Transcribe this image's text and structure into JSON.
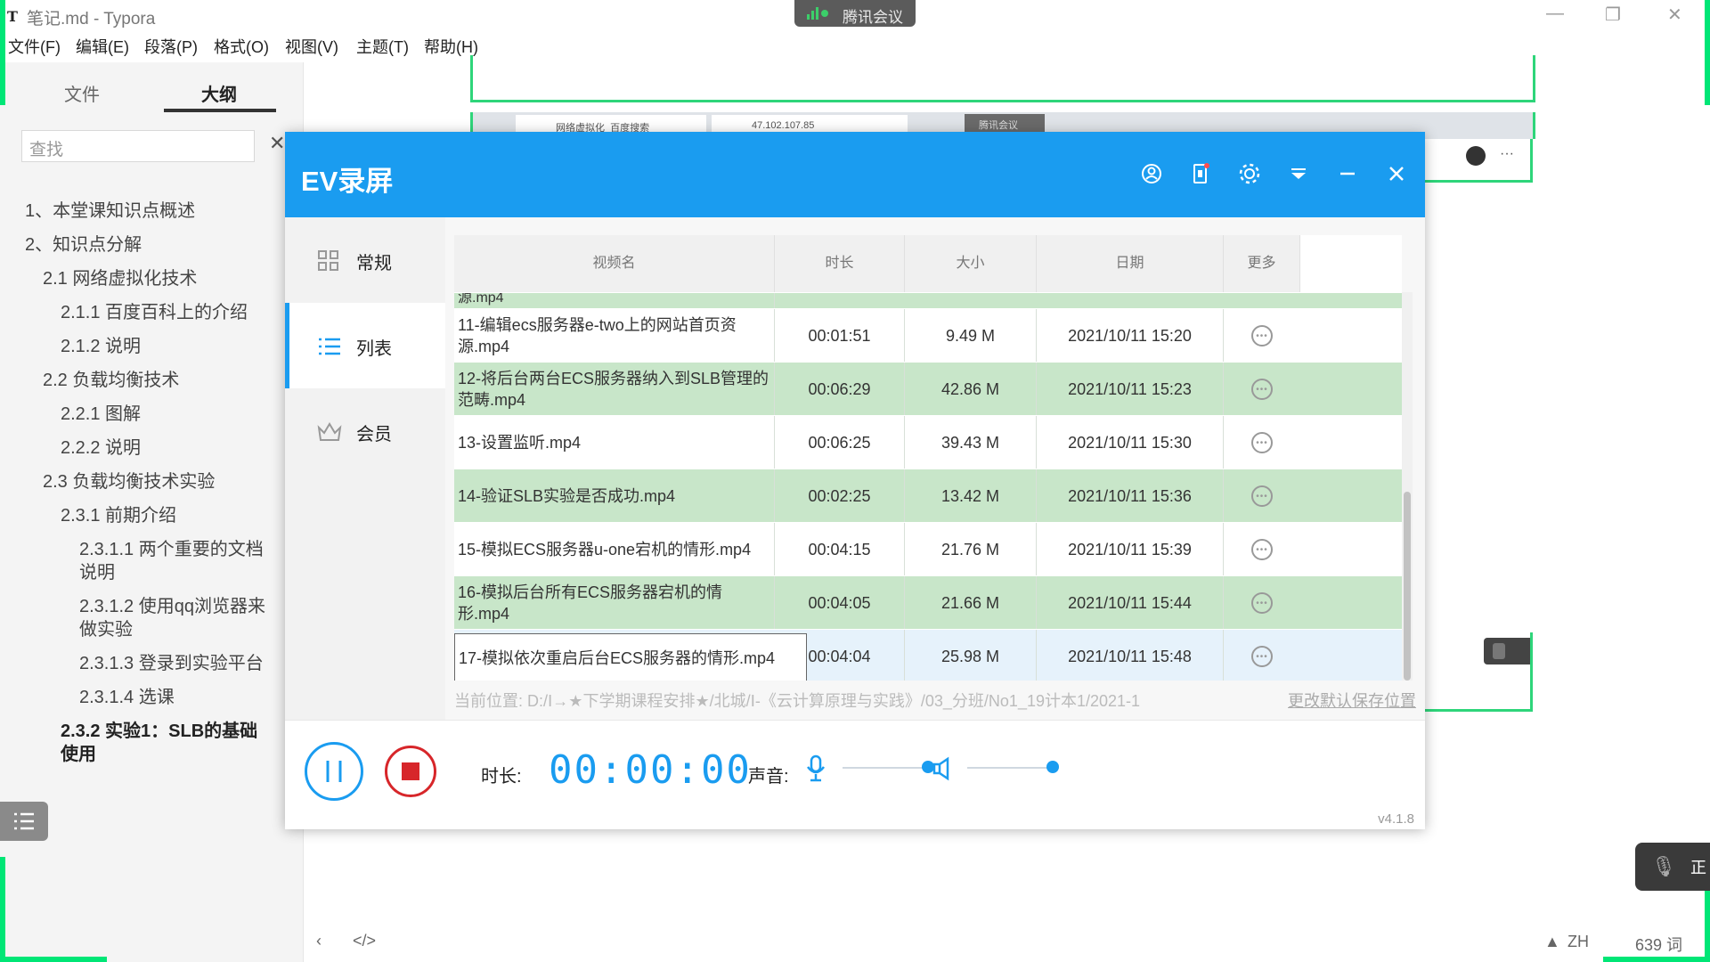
{
  "typora": {
    "app_icon": "T",
    "title": "笔记.md - Typora",
    "menu": [
      "文件(F)",
      "编辑(E)",
      "段落(P)",
      "格式(O)",
      "视图(V)",
      "主题(T)",
      "帮助(H)"
    ],
    "sidebar_tabs": [
      "文件",
      "大纲"
    ],
    "search_placeholder": "查找",
    "outline": [
      {
        "label": "1、本堂课知识点概述"
      },
      {
        "label": "2、知识点分解"
      },
      {
        "label": "2.1 网络虚拟化技术"
      },
      {
        "label": "2.1.1 百度百科上的介绍"
      },
      {
        "label": "2.1.2 说明"
      },
      {
        "label": "2.2 负载均衡技术"
      },
      {
        "label": "2.2.1 图解"
      },
      {
        "label": "2.2.2 说明"
      },
      {
        "label": "2.3 负载均衡技术实验"
      },
      {
        "label": "2.3.1 前期介绍"
      },
      {
        "label": "2.3.1.1 两个重要的文档"
      },
      {
        "label": "说明"
      },
      {
        "label": "2.3.1.2 使用qq浏览器来"
      },
      {
        "label": "做实验"
      },
      {
        "label": "2.3.1.3 登录到实验平台"
      },
      {
        "label": "2.3.1.4 选课"
      },
      {
        "label": "2.3.2 实验1：SLB的基础"
      },
      {
        "label": "使用"
      }
    ],
    "status": {
      "lang": "ZH",
      "word_count": "639 词"
    }
  },
  "tencent_meeting": {
    "label": "腾讯会议"
  },
  "background_browser": {
    "tab1": "网络虚拟化_百度搜索",
    "tab2": "47.102.107.85",
    "chip": "腾讯会议"
  },
  "ev": {
    "title": "EV录屏",
    "nav": [
      {
        "label": "常规",
        "icon": "grid-icon"
      },
      {
        "label": "列表",
        "icon": "list-icon"
      },
      {
        "label": "会员",
        "icon": "crown-icon"
      }
    ],
    "columns": [
      "视频名",
      "时长",
      "大小",
      "日期",
      "更多"
    ],
    "partial_row": "源.mp4",
    "rows": [
      {
        "name": "11-编辑ecs服务器e-two上的网站首页资源.mp4",
        "line1": "11-编辑ecs服务器e-two上的网站首页资",
        "line2": "源.mp4",
        "duration": "00:01:51",
        "size": "9.49 M",
        "date": "2021/10/11 15:20"
      },
      {
        "name": "12-将后台两台ECS服务器纳入到SLB管理的范畴.mp4",
        "line1": "12-将后台两台ECS服务器纳入到SLB管理的",
        "line2": "范畴.mp4",
        "duration": "00:06:29",
        "size": "42.86 M",
        "date": "2021/10/11 15:23"
      },
      {
        "name": "13-设置监听.mp4",
        "line1": "13-设置监听.mp4",
        "line2": "",
        "duration": "00:06:25",
        "size": "39.43 M",
        "date": "2021/10/11 15:30"
      },
      {
        "name": "14-验证SLB实验是否成功.mp4",
        "line1": "14-验证SLB实验是否成功.mp4",
        "line2": "",
        "duration": "00:02:25",
        "size": "13.42 M",
        "date": "2021/10/11 15:36"
      },
      {
        "name": "15-模拟ECS服务器u-one宕机的情形.mp4",
        "line1": "15-模拟ECS服务器u-one宕机的情形.mp4",
        "line2": "",
        "duration": "00:04:15",
        "size": "21.76 M",
        "date": "2021/10/11 15:39"
      },
      {
        "name": "16-模拟后台所有ECS服务器宕机的情形.mp4",
        "line1": "16-模拟后台所有ECS服务器宕机的情",
        "line2": "形.mp4",
        "duration": "00:04:05",
        "size": "21.66 M",
        "date": "2021/10/11 15:44"
      },
      {
        "name": "17-模拟依次重启后台ECS服务器的情形.mp4",
        "line1": "17-模拟依次重启后台ECS服务器的情形.mp4",
        "line2": "",
        "duration": "00:04:04",
        "size": "25.98 M",
        "date": "2021/10/11 15:48"
      }
    ],
    "path_text": "当前位置: D:/Ⅰ→★下学期课程安排★/北城/Ⅰ-《云计算原理与实践》/03_分班/No1_19计本1/2021-1",
    "change_path": "更改默认保存位置",
    "duration_label": "时长:",
    "timer": "00:00:00",
    "sound_label": "声音:",
    "mic_level": 1.0,
    "speaker_level": 1.0,
    "version": "v4.1.8",
    "accent": "#1a9cf0",
    "stop_color": "#d7262a",
    "row_green": "#c8e6c9"
  },
  "side_chip_text": "正"
}
